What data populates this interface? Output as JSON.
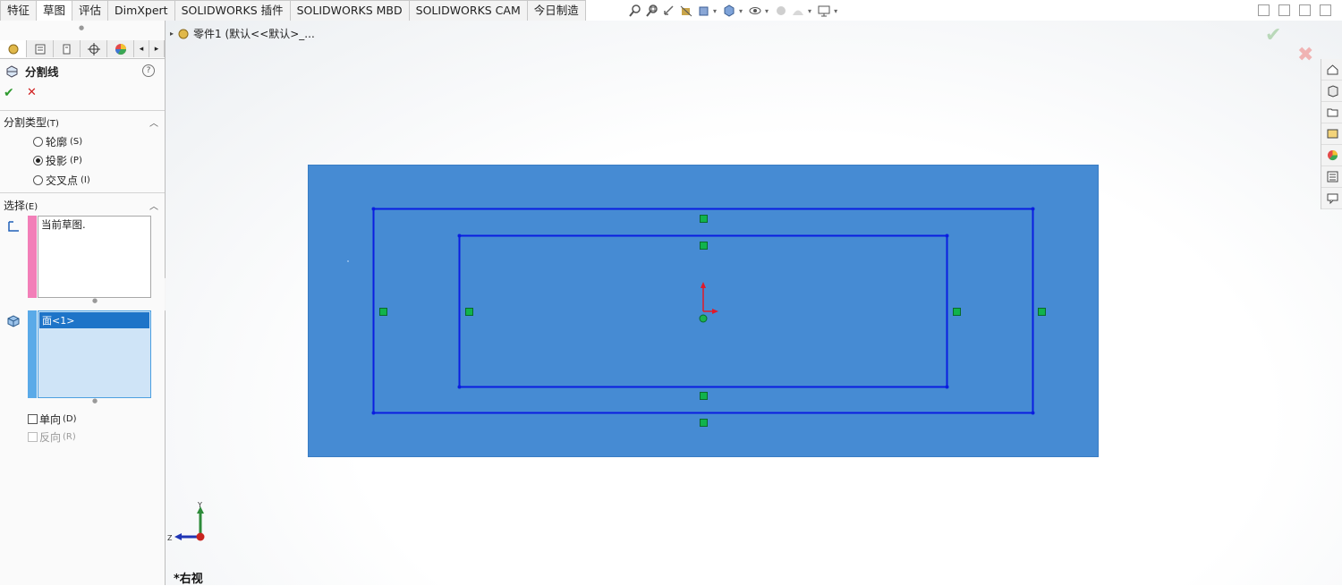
{
  "tabs": [
    {
      "label": "特征",
      "active": false
    },
    {
      "label": "草图",
      "active": true
    },
    {
      "label": "评估",
      "active": false
    },
    {
      "label": "DimXpert",
      "active": false
    },
    {
      "label": "SOLIDWORKS 插件",
      "active": false
    },
    {
      "label": "SOLIDWORKS MBD",
      "active": false
    },
    {
      "label": "SOLIDWORKS CAM",
      "active": false
    },
    {
      "label": "今日制造",
      "active": false
    }
  ],
  "breadcrumb": {
    "text": "零件1  (默认<<默认>_..."
  },
  "property_manager": {
    "title": "分割线",
    "help": "?",
    "split_type": {
      "title": "分割类型",
      "accel": "(T)",
      "options": [
        {
          "label": "轮廓",
          "accel": "(S)",
          "selected": false
        },
        {
          "label": "投影",
          "accel": "(P)",
          "selected": true
        },
        {
          "label": "交叉点",
          "accel": "(I)",
          "selected": false
        }
      ]
    },
    "selection": {
      "title": "选择",
      "accel": "(E)",
      "sketch_box": "当前草图.",
      "face_box": "面<1>",
      "single_direction": {
        "label": "单向",
        "accel": "(D)",
        "checked": false
      },
      "reverse": {
        "label": "反向",
        "accel": "(R)",
        "checked": false,
        "enabled": false
      }
    }
  },
  "view_label": "*右视",
  "triad": {
    "y": "Y",
    "z": "Z"
  },
  "colors": {
    "face": "#468bd3",
    "sketch": "#0a1ee0",
    "pink_bar": "#f27fb8",
    "blue_bar": "#5aaae8",
    "relation": "#11b34c"
  }
}
